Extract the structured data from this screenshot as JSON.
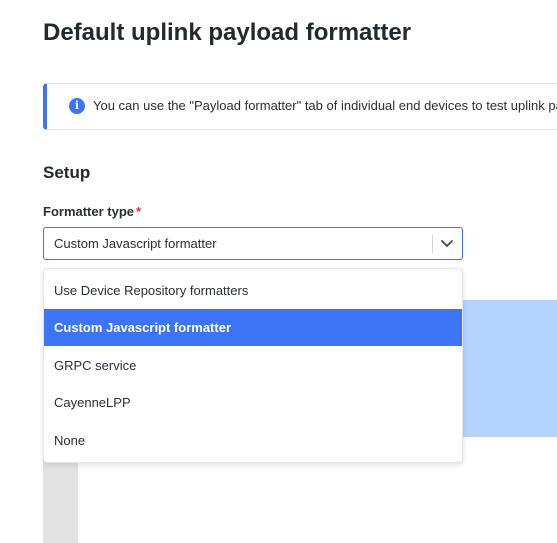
{
  "page": {
    "title": "Default uplink payload formatter"
  },
  "notice": {
    "icon": "info-icon",
    "text": "You can use the \"Payload formatter\" tab of individual end devices to test uplink payload formatters"
  },
  "setup": {
    "section_title": "Setup",
    "formatter_type": {
      "label": "Formatter type",
      "required_mark": "*",
      "value": "Custom Javascript formatter",
      "options": [
        {
          "label": "Use Device Repository formatters",
          "selected": false
        },
        {
          "label": "Custom Javascript formatter",
          "selected": true
        },
        {
          "label": "GRPC service",
          "selected": false
        },
        {
          "label": "CayenneLPP",
          "selected": false
        },
        {
          "label": "None",
          "selected": false
        }
      ]
    }
  },
  "colors": {
    "accent": "#3d73f5",
    "required": "#db2e2e",
    "backdrop_blue": "#b4d4ff",
    "backdrop_gray": "#e3e3e3"
  }
}
